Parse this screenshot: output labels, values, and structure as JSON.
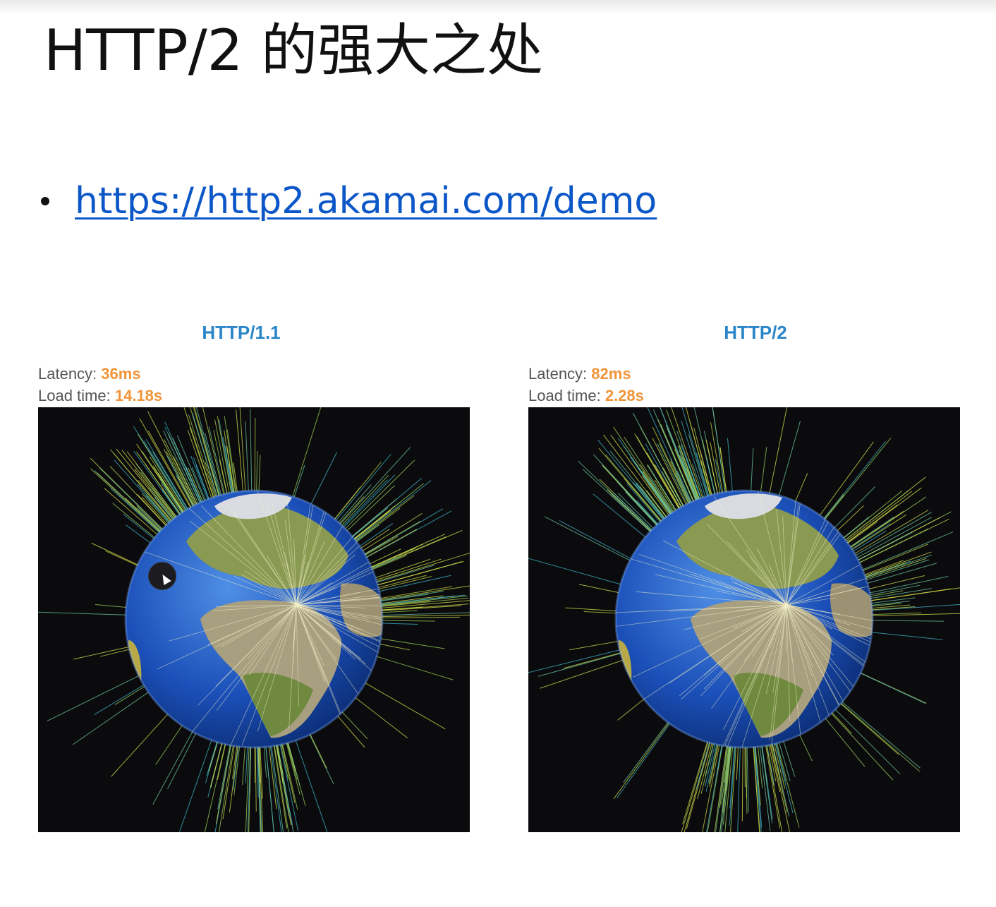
{
  "slide": {
    "title": "HTTP/2 的强大之处",
    "link_text": "https://http2.akamai.com/demo"
  },
  "panels": [
    {
      "title": "HTTP/1.1",
      "latency_label": "Latency: ",
      "latency_value": "36ms",
      "load_label": "Load time: ",
      "load_value": "14.18s"
    },
    {
      "title": "HTTP/2",
      "latency_label": "Latency: ",
      "latency_value": "82ms",
      "load_label": "Load time: ",
      "load_value": "2.28s"
    }
  ],
  "colors": {
    "link": "#0c57c8",
    "panel_title": "#2a86c8",
    "stat_value": "#f0953a",
    "globe_background": "#0b0b0d"
  }
}
